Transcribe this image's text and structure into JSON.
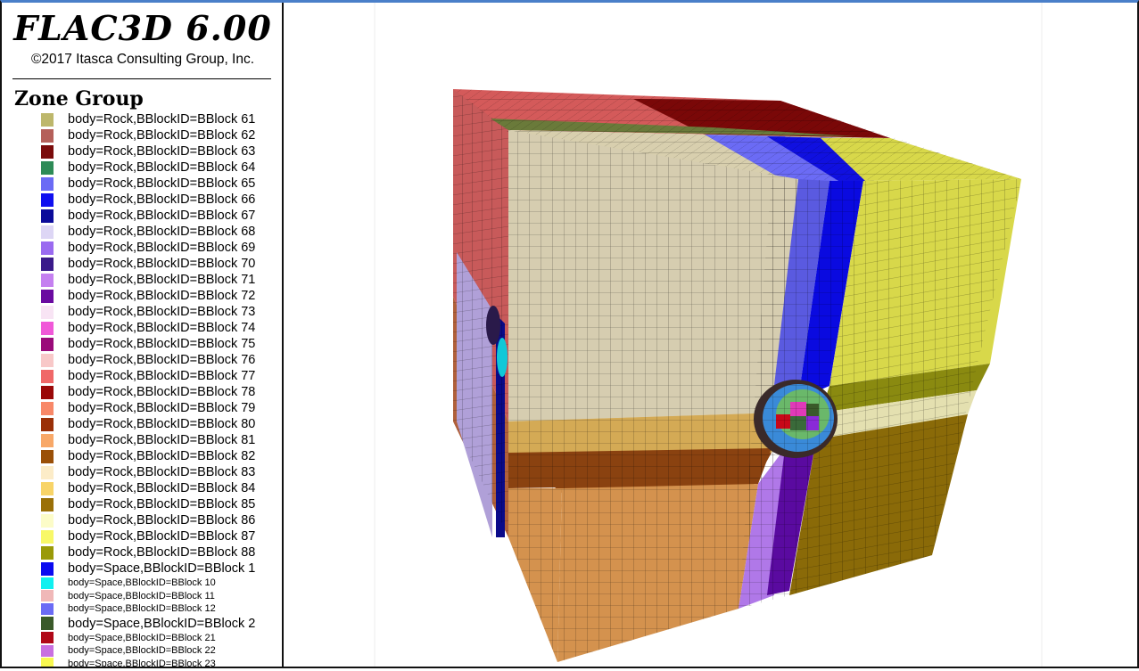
{
  "app": {
    "title": "FLAC3D 6.00",
    "copyright": "©2017 Itasca Consulting Group, Inc."
  },
  "legend": {
    "title": "Zone Group",
    "items": [
      {
        "label": "body=Rock,BBlockID=BBlock 61",
        "color": "#bdb76b",
        "size": "normal"
      },
      {
        "label": "body=Rock,BBlockID=BBlock 62",
        "color": "#b5605a",
        "size": "normal"
      },
      {
        "label": "body=Rock,BBlockID=BBlock 63",
        "color": "#7a0b0b",
        "size": "normal"
      },
      {
        "label": "body=Rock,BBlockID=BBlock 64",
        "color": "#2e8b57",
        "size": "normal"
      },
      {
        "label": "body=Rock,BBlockID=BBlock 65",
        "color": "#6b6bf5",
        "size": "normal"
      },
      {
        "label": "body=Rock,BBlockID=BBlock 66",
        "color": "#1010f0",
        "size": "normal"
      },
      {
        "label": "body=Rock,BBlockID=BBlock 67",
        "color": "#0b0b9a",
        "size": "normal"
      },
      {
        "label": "body=Rock,BBlockID=BBlock 68",
        "color": "#ddd6f5",
        "size": "normal"
      },
      {
        "label": "body=Rock,BBlockID=BBlock 69",
        "color": "#9a6af0",
        "size": "normal"
      },
      {
        "label": "body=Rock,BBlockID=BBlock 70",
        "color": "#3a1a8a",
        "size": "normal"
      },
      {
        "label": "body=Rock,BBlockID=BBlock 71",
        "color": "#c580f0",
        "size": "normal"
      },
      {
        "label": "body=Rock,BBlockID=BBlock 72",
        "color": "#6a0aa0",
        "size": "normal"
      },
      {
        "label": "body=Rock,BBlockID=BBlock 73",
        "color": "#f8e4f4",
        "size": "normal"
      },
      {
        "label": "body=Rock,BBlockID=BBlock 74",
        "color": "#f058d8",
        "size": "normal"
      },
      {
        "label": "body=Rock,BBlockID=BBlock 75",
        "color": "#9a0a7a",
        "size": "normal"
      },
      {
        "label": "body=Rock,BBlockID=BBlock 76",
        "color": "#f8c8c8",
        "size": "normal"
      },
      {
        "label": "body=Rock,BBlockID=BBlock 77",
        "color": "#f06868",
        "size": "normal"
      },
      {
        "label": "body=Rock,BBlockID=BBlock 78",
        "color": "#9a0808",
        "size": "normal"
      },
      {
        "label": "body=Rock,BBlockID=BBlock 79",
        "color": "#f88868",
        "size": "normal"
      },
      {
        "label": "body=Rock,BBlockID=BBlock 80",
        "color": "#9a3008",
        "size": "normal"
      },
      {
        "label": "body=Rock,BBlockID=BBlock 81",
        "color": "#f8a868",
        "size": "normal"
      },
      {
        "label": "body=Rock,BBlockID=BBlock 82",
        "color": "#9a5008",
        "size": "normal"
      },
      {
        "label": "body=Rock,BBlockID=BBlock 83",
        "color": "#fcecc8",
        "size": "normal"
      },
      {
        "label": "body=Rock,BBlockID=BBlock 84",
        "color": "#f8d468",
        "size": "normal"
      },
      {
        "label": "body=Rock,BBlockID=BBlock 85",
        "color": "#9a7008",
        "size": "normal"
      },
      {
        "label": "body=Rock,BBlockID=BBlock 86",
        "color": "#fcfcc8",
        "size": "normal"
      },
      {
        "label": "body=Rock,BBlockID=BBlock 87",
        "color": "#f8f868",
        "size": "normal"
      },
      {
        "label": "body=Rock,BBlockID=BBlock 88",
        "color": "#9a9a08",
        "size": "normal"
      },
      {
        "label": "body=Space,BBlockID=BBlock 1",
        "color": "#0a0af0",
        "size": "normal"
      },
      {
        "label": "body=Space,BBlockID=BBlock 10",
        "color": "#10f0f0",
        "size": "small"
      },
      {
        "label": "body=Space,BBlockID=BBlock 11",
        "color": "#f0b8b8",
        "size": "small"
      },
      {
        "label": "body=Space,BBlockID=BBlock 12",
        "color": "#6b6bf5",
        "size": "small"
      },
      {
        "label": "body=Space,BBlockID=BBlock 2",
        "color": "#3a5a2a",
        "size": "normal"
      },
      {
        "label": "body=Space,BBlockID=BBlock 21",
        "color": "#b00818",
        "size": "small"
      },
      {
        "label": "body=Space,BBlockID=BBlock 22",
        "color": "#c870e0",
        "size": "small"
      },
      {
        "label": "body=Space,BBlockID=BBlock 23",
        "color": "#f8f850",
        "size": "small"
      }
    ]
  }
}
